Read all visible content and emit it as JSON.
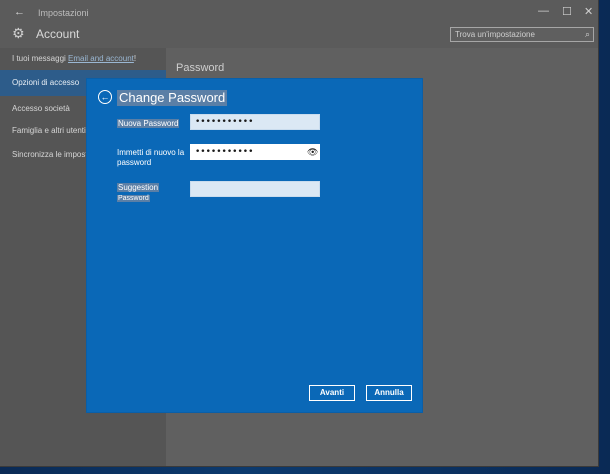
{
  "window": {
    "title": "Impostazioni",
    "app_title": "Account",
    "controls": {
      "minimize": "—",
      "maximize": "☐",
      "close": "✕"
    }
  },
  "search": {
    "placeholder": "Trova un'impostazione",
    "icon": "search-icon"
  },
  "sidebar": {
    "items": [
      {
        "label": "I tuoi messaggi",
        "link": "Email and account",
        "suffix": "!"
      },
      {
        "label": "Opzioni di accesso",
        "active": true
      },
      {
        "label": "Accesso società"
      },
      {
        "label": "Famiglia e altri utenti"
      },
      {
        "label": "Sincronizza le impostazioni"
      }
    ]
  },
  "content": {
    "title": "Password"
  },
  "dialog": {
    "title": "Change Password",
    "fields": {
      "new_password": {
        "label": "Nuova Password",
        "value": "•••••••••••"
      },
      "confirm_password": {
        "label_line1": "Immetti di nuovo la",
        "label_line2": "password",
        "value": "•••••••••••"
      },
      "hint": {
        "label_line1": "Suggestion",
        "label_line2": "Password",
        "value": ""
      }
    },
    "buttons": {
      "next": "Avanti",
      "cancel": "Annulla"
    }
  },
  "colors": {
    "dialog_bg": "#0a68b7",
    "sidebar_active": "#2d5c8a",
    "window_bg": "#5b5b5b"
  }
}
